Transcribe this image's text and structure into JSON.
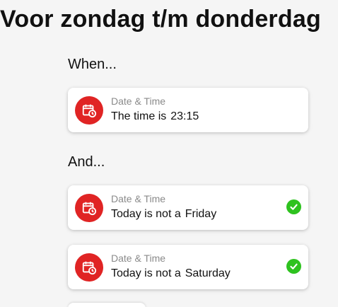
{
  "page": {
    "title": "Voor zondag t/m donderdag"
  },
  "sections": {
    "when_label": "When...",
    "and_label": "And..."
  },
  "cards": [
    {
      "kind": "Date & Time",
      "prefix": "The time is",
      "value": "23:15",
      "icon": "calendar-clock-icon",
      "checked": false
    },
    {
      "kind": "Date & Time",
      "prefix": "Today is not a",
      "value": "Friday",
      "icon": "calendar-clock-icon",
      "checked": true
    },
    {
      "kind": "Date & Time",
      "prefix": "Today is not a",
      "value": "Saturday",
      "icon": "calendar-clock-icon",
      "checked": true
    }
  ],
  "colors": {
    "icon_background": "#e02424",
    "check_green": "#2ec21f",
    "card_background": "#ffffff",
    "page_background": "#f5f5f5"
  }
}
